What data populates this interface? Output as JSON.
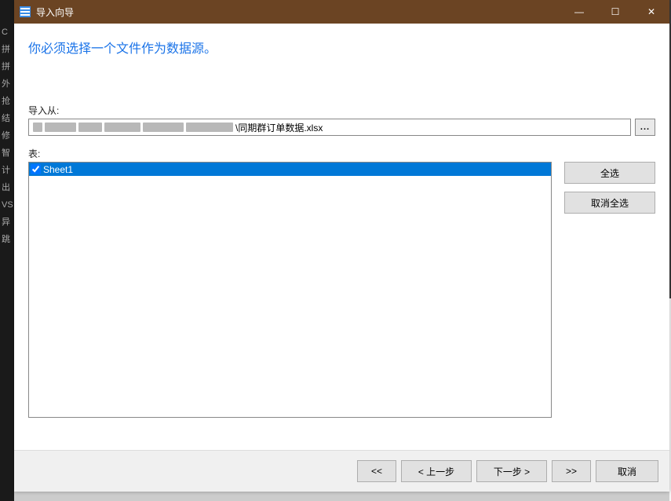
{
  "titlebar": {
    "title": "导入向导",
    "minimize_glyph": "—",
    "maximize_glyph": "☐",
    "close_glyph": "✕"
  },
  "heading": "你必须选择一个文件作为数据源。",
  "import": {
    "label": "导入从:",
    "path_visible_suffix": "\\同期群订单数据.xlsx",
    "browse_label": "..."
  },
  "tables": {
    "label": "表:",
    "items": [
      {
        "name": "Sheet1",
        "checked": true,
        "selected": true
      }
    ]
  },
  "side_buttons": {
    "select_all": "全选",
    "deselect_all": "取消全选"
  },
  "footer": {
    "first": "<<",
    "prev": "<  上一步",
    "next": "下一步  >",
    "last": ">>",
    "cancel": "取消"
  }
}
